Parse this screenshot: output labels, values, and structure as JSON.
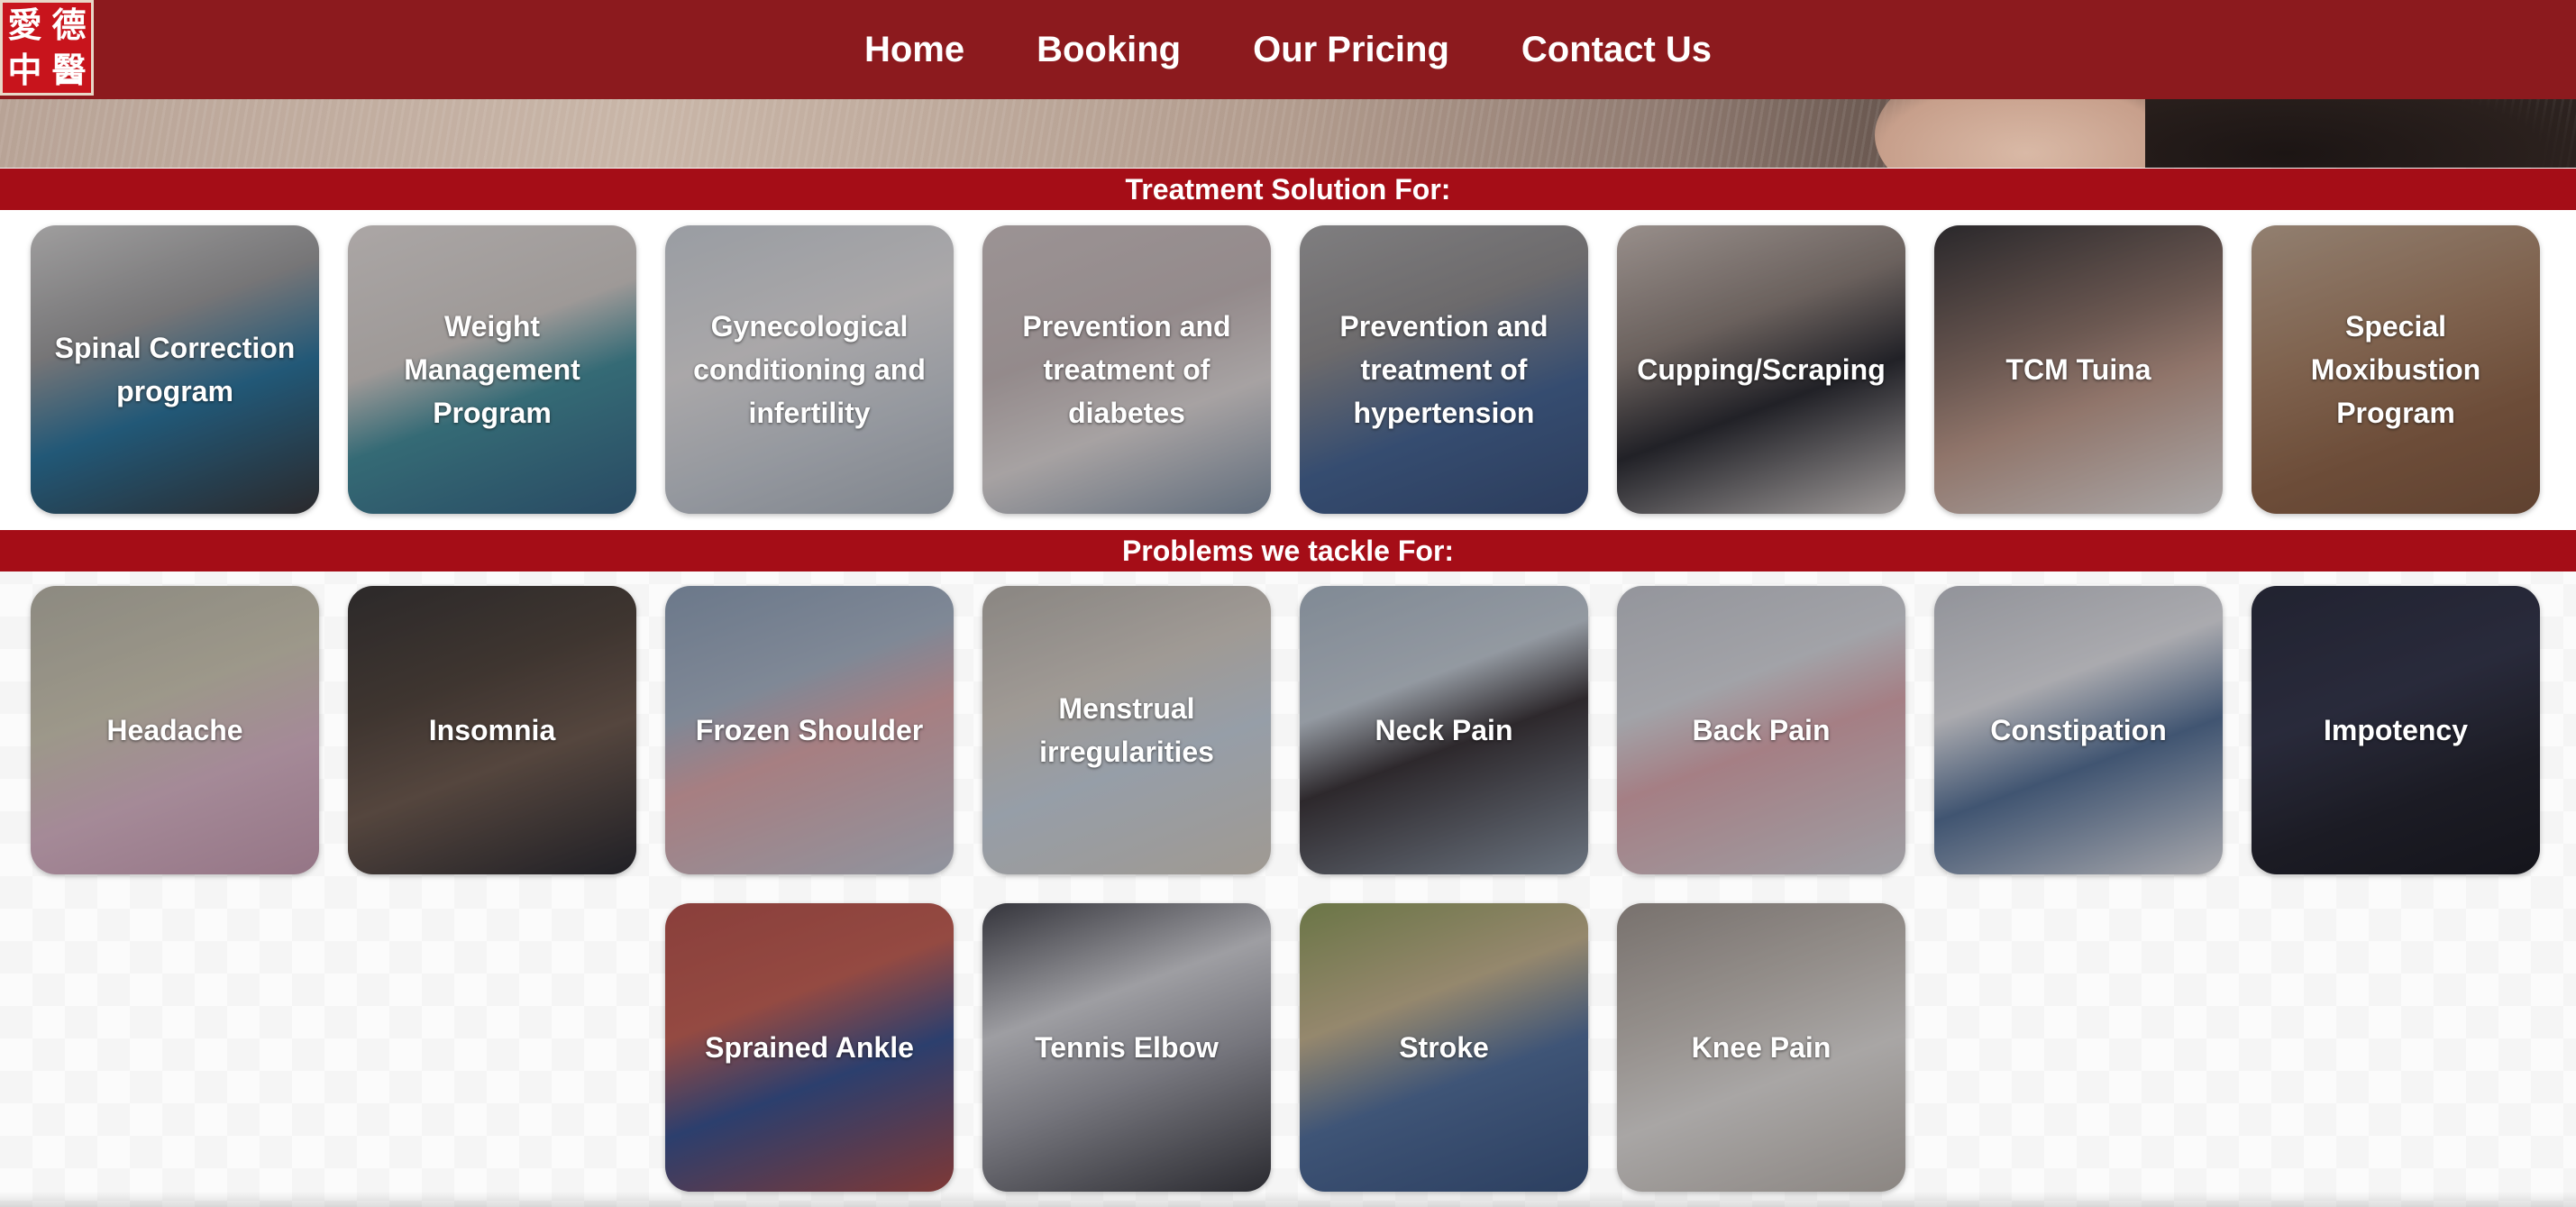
{
  "brand": {
    "logo_chars": [
      "愛",
      "德",
      "中",
      "醫"
    ]
  },
  "nav": {
    "items": [
      {
        "label": "Home"
      },
      {
        "label": "Booking"
      },
      {
        "label": "Our Pricing"
      },
      {
        "label": "Contact Us"
      }
    ]
  },
  "treatments": {
    "heading": "Treatment Solution For:",
    "cards": [
      {
        "label": "Spinal Correction program"
      },
      {
        "label": "Weight Management Program"
      },
      {
        "label": "Gynecological conditioning and infertility"
      },
      {
        "label": "Prevention and treatment of diabetes"
      },
      {
        "label": "Prevention and treatment of hypertension"
      },
      {
        "label": "Cupping/Scraping"
      },
      {
        "label": "TCM Tuina"
      },
      {
        "label": "Special Moxibustion Program"
      }
    ]
  },
  "problems": {
    "heading": "Problems we tackle For:",
    "cards": [
      {
        "label": "Headache"
      },
      {
        "label": "Insomnia"
      },
      {
        "label": "Frozen Shoulder"
      },
      {
        "label": "Menstrual irregularities"
      },
      {
        "label": "Neck Pain"
      },
      {
        "label": "Back Pain"
      },
      {
        "label": "Constipation"
      },
      {
        "label": "Impotency"
      },
      {
        "label": "Sprained Ankle"
      },
      {
        "label": "Tennis Elbow"
      },
      {
        "label": "Stroke"
      },
      {
        "label": "Knee Pain"
      }
    ]
  },
  "colors": {
    "header_bg": "#8c1a1e",
    "section_bar_bg": "#a50d17",
    "logo_bg": "#c8141c",
    "text_light": "#ffffff"
  }
}
